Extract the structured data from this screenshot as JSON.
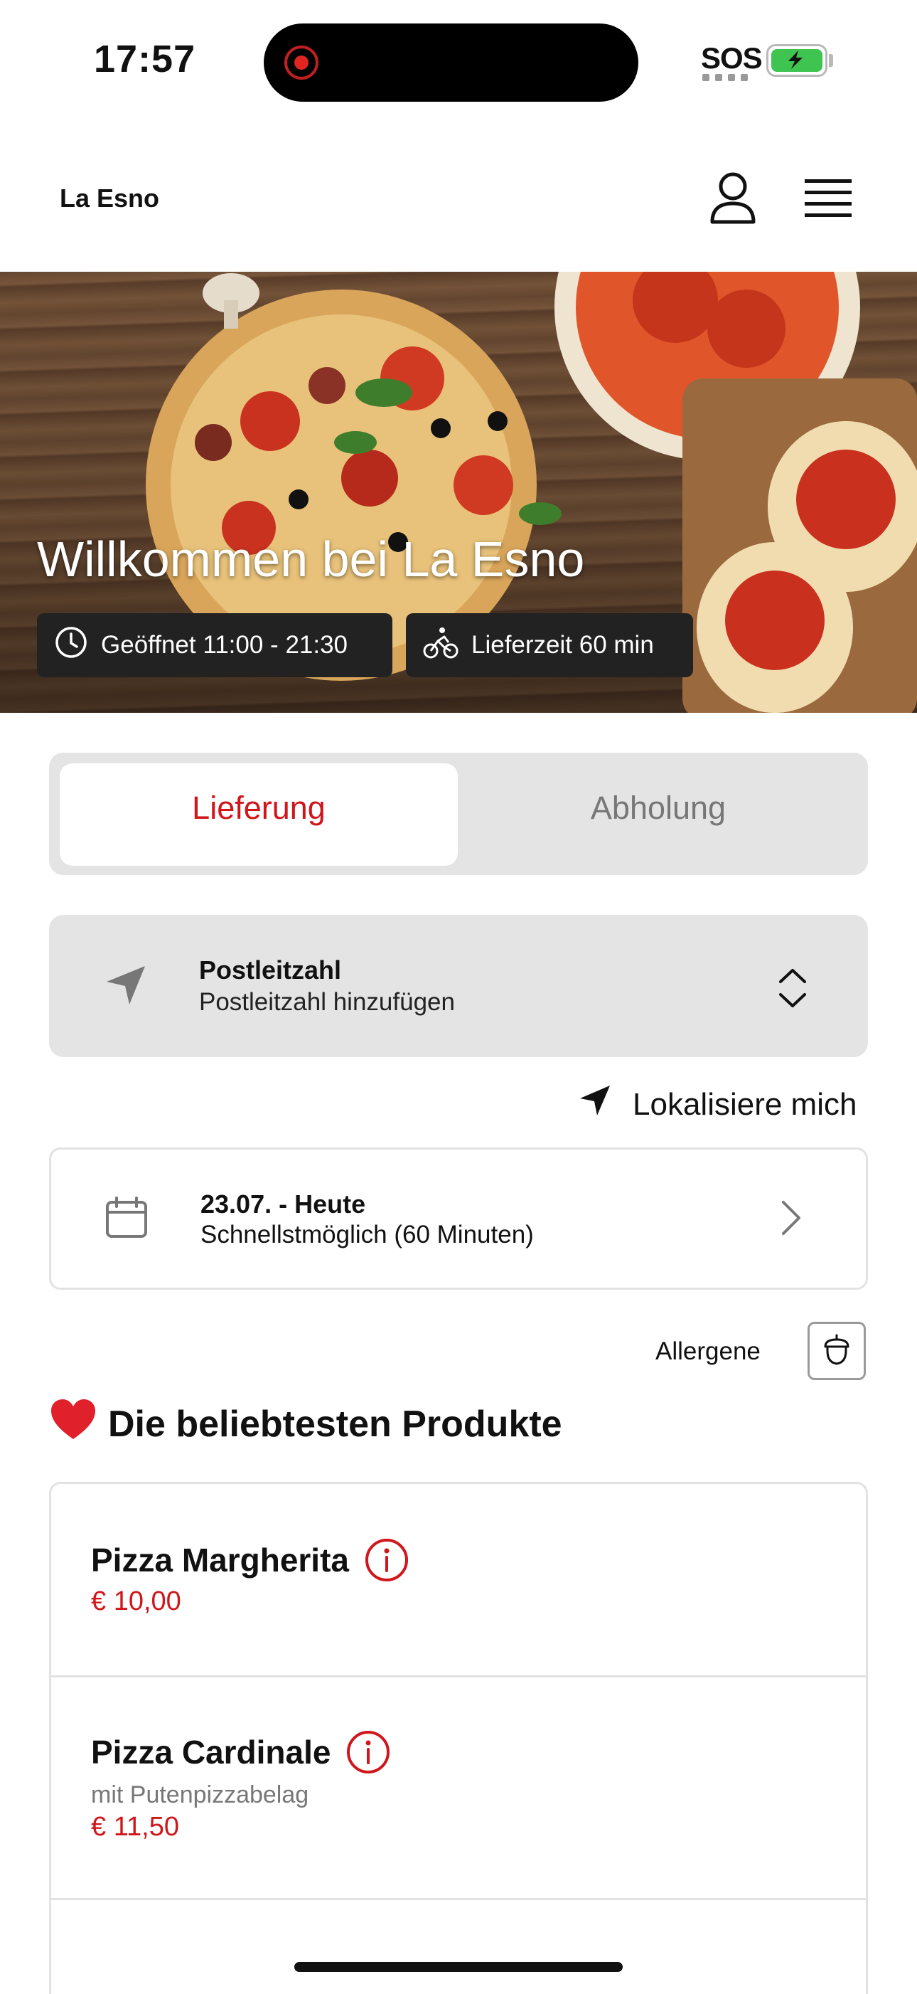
{
  "status_bar": {
    "time": "17:57",
    "sos": "SOS"
  },
  "header": {
    "brand": "La Esno"
  },
  "hero": {
    "title": "Willkommen bei La Esno",
    "open_hours": "Geöffnet 11:00 - 21:30",
    "delivery_time": "Lieferzeit 60 min"
  },
  "order_mode": {
    "options": [
      "Lieferung",
      "Abholung"
    ],
    "selected": "Lieferung"
  },
  "postal": {
    "title": "Postleitzahl",
    "placeholder": "Postleitzahl hinzufügen"
  },
  "locate": {
    "label": "Lokalisiere mich"
  },
  "date_select": {
    "title": "23.07. - Heute",
    "subtitle": "Schnellstmöglich (60 Minuten)"
  },
  "allergens": {
    "label": "Allergene"
  },
  "section": {
    "title": "Die beliebtesten Produkte"
  },
  "products": [
    {
      "name": "Pizza Margherita",
      "description": "",
      "price": "€ 10,00"
    },
    {
      "name": "Pizza Cardinale",
      "description": "mit Putenpizzabelag",
      "price": "€ 11,50"
    }
  ],
  "colors": {
    "accent": "#d0161b",
    "segment_bg": "#e4e4e4",
    "chip_bg": "#222222"
  },
  "icons": {
    "user": "user-icon",
    "menu": "menu-icon",
    "clock": "clock-icon",
    "bike": "bike-icon",
    "location": "location-arrow-icon",
    "chevrons": "chevron-up-down-icon",
    "calendar": "calendar-icon",
    "chevron_right": "chevron-right-icon",
    "allergen": "acorn-icon",
    "heart": "heart-icon",
    "info": "info-icon"
  }
}
